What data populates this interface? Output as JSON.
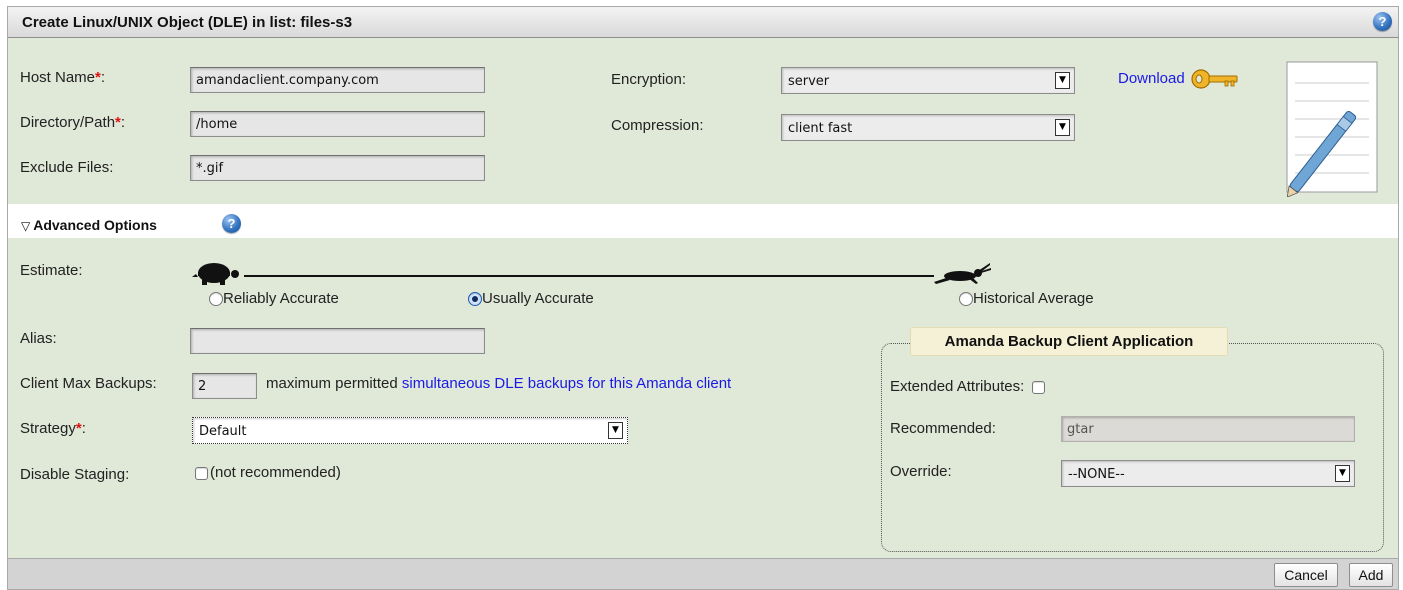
{
  "header": {
    "title": "Create Linux/UNIX Object (DLE) in list: files-s3",
    "help_icon": "question-mark-icon"
  },
  "main": {
    "host_name": {
      "label": "Host Name",
      "required_mark": "*",
      "colon": ":",
      "value": "amandaclient.company.com"
    },
    "directory_path": {
      "label": "Directory/Path",
      "required_mark": "*",
      "colon": ":",
      "value": "/home"
    },
    "exclude_files": {
      "label": "Exclude Files:",
      "value": "*.gif"
    },
    "encryption": {
      "label": "Encryption:",
      "selected": "server"
    },
    "compression": {
      "label": "Compression:",
      "selected": "client fast"
    },
    "download": {
      "label": "Download",
      "icon": "key-icon"
    },
    "notepad_icon": "notepad-pencil-icon"
  },
  "advanced": {
    "toggle_label": "Advanced Options",
    "toggle_icon": "triangle-down-icon",
    "help_icon": "question-mark-icon",
    "estimate": {
      "label": "Estimate:",
      "slow_icon": "tortoise-icon",
      "fast_icon": "hare-icon",
      "options": [
        "Reliably Accurate",
        "Usually Accurate",
        "Historical Average"
      ],
      "selected": "Usually Accurate"
    },
    "alias": {
      "label": "Alias:",
      "value": ""
    },
    "client_max_backups": {
      "label": "Client Max Backups:",
      "value": "2",
      "note_prefix": "maximum permitted",
      "note_link": "simultaneous DLE backups for this Amanda client"
    },
    "strategy": {
      "label": "Strategy",
      "required_mark": "*",
      "colon": ":",
      "selected": "Default"
    },
    "disable_staging": {
      "label": "Disable Staging:",
      "checkbox_label": "(not recommended)",
      "checked": false
    },
    "application": {
      "legend": "Amanda Backup Client Application",
      "extended_attributes": {
        "label": "Extended Attributes:",
        "checked": false
      },
      "recommended": {
        "label": "Recommended:",
        "value": "gtar"
      },
      "override": {
        "label": "Override:",
        "selected": "--NONE--"
      }
    }
  },
  "footer": {
    "cancel_label": "Cancel",
    "add_label": "Add"
  },
  "colors": {
    "panel_background": "#e0e8d8",
    "required_marker": "#e01010",
    "link": "#1a1ae6",
    "help_icon": "#2f6fbd"
  }
}
